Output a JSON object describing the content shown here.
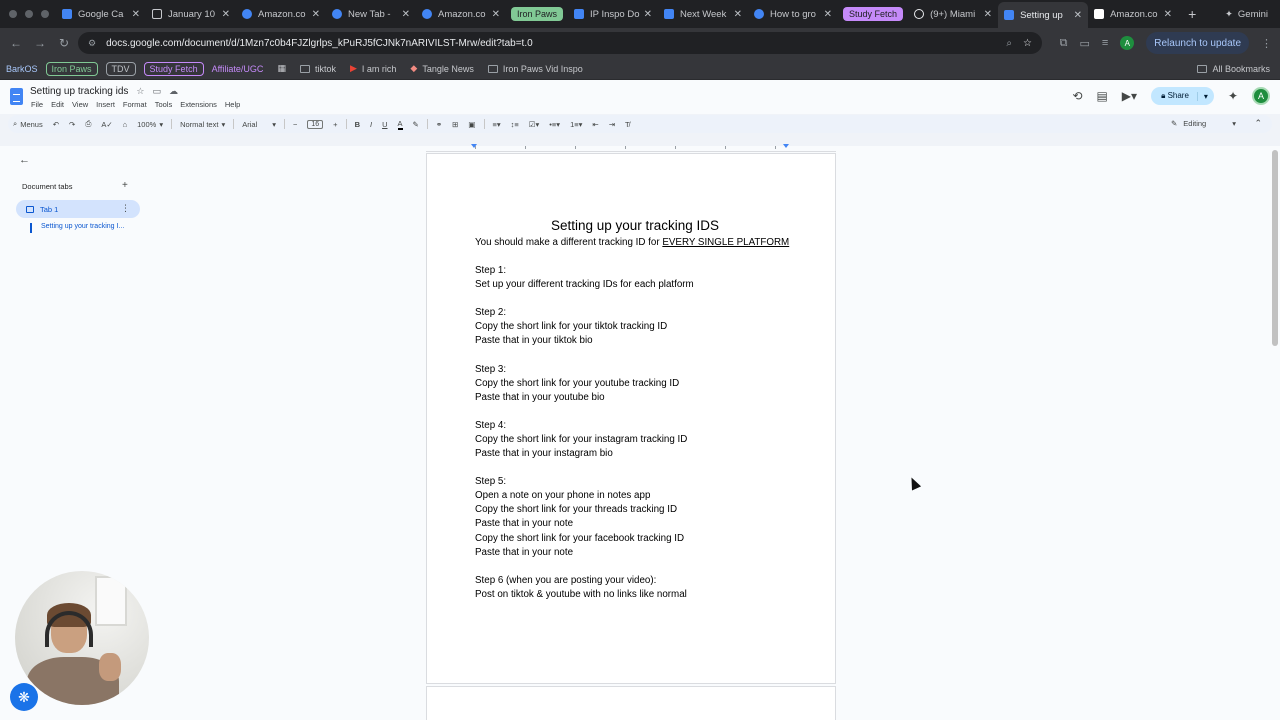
{
  "browser": {
    "tabs": [
      {
        "title": "Google Ca",
        "icon": "calendar-icon",
        "color": "#4285f4"
      },
      {
        "title": "January 10",
        "icon": "pen-icon",
        "color": "#c6c8cc"
      },
      {
        "title": "Amazon.co",
        "icon": "circle-icon",
        "color": "#4285f4"
      },
      {
        "title": "New Tab -",
        "icon": "circle-icon",
        "color": "#4285f4"
      },
      {
        "title": "Amazon.co",
        "icon": "circle-icon",
        "color": "#4285f4"
      }
    ],
    "group_iron": {
      "label": "Iron Paws",
      "color": "#81c995"
    },
    "tabs2": [
      {
        "title": "IP Inspo Do",
        "icon": "docs-icon",
        "color": "#4285f4"
      },
      {
        "title": "Next Week",
        "icon": "docs-icon",
        "color": "#4285f4"
      },
      {
        "title": "How to gro",
        "icon": "circle-icon",
        "color": "#4285f4"
      }
    ],
    "group_study": {
      "label": "Study Fetch",
      "color": "#c58af9"
    },
    "tabs3": [
      {
        "title": "(9+) Miami",
        "icon": "threads-icon",
        "color": "#e8eaed"
      },
      {
        "title": "Setting up",
        "icon": "docs-icon",
        "color": "#4285f4",
        "active": true
      },
      {
        "title": "Amazon.co",
        "icon": "amazon-icon",
        "color": "#ffffff"
      }
    ],
    "new_tab": "+",
    "gemini": "Gemini",
    "url": "docs.google.com/document/d/1Mzn7c0b4FJZlgrlps_kPuRJ5fCJNk7nARIVILST-Mrw/edit?tab=t.0",
    "relaunch": "Relaunch to update",
    "profile_initial": "A"
  },
  "bookmarks": {
    "items": [
      {
        "label": "BarkOS",
        "type": "text",
        "color": "#a8c7fa"
      },
      {
        "label": "Iron Paws",
        "type": "chip",
        "color": "#81c995"
      },
      {
        "label": "TDV",
        "type": "chip",
        "color": "#9aa0a6"
      },
      {
        "label": "Study Fetch",
        "type": "chip",
        "color": "#c58af9"
      },
      {
        "label": "Affiliate/UGC",
        "type": "text",
        "color": "#c58af9"
      }
    ],
    "folders": [
      "tiktok",
      "I am rich",
      "Tangle News",
      "Iron Paws Vid Inspo"
    ],
    "all": "All Bookmarks"
  },
  "docs": {
    "title": "Setting up tracking ids",
    "menu": [
      "File",
      "Edit",
      "View",
      "Insert",
      "Format",
      "Tools",
      "Extensions",
      "Help"
    ],
    "share": "Share",
    "profile_initial": "A",
    "toolbar": {
      "menus": "Menus",
      "zoom": "100%",
      "style": "Normal text",
      "font": "Arial",
      "font_size": "16",
      "mode": "Editing"
    },
    "side": {
      "tabs_header": "Document tabs",
      "tab_name": "Tab 1",
      "outline_item": "Setting up your tracking I..."
    },
    "content": {
      "heading": "Setting up your tracking IDS",
      "intro_prefix": "You should make a different tracking ID for ",
      "intro_underlined": "EVERY SINGLE PLATFORM",
      "steps": [
        "Step 1:\nSet up your different tracking IDs for each platform",
        "Step 2:\nCopy the short link for your tiktok tracking ID\nPaste that in your tiktok bio",
        "Step 3:\nCopy the short link for your youtube tracking ID\nPaste that in your youtube bio",
        "Step 4:\nCopy the short link for your instagram tracking ID\nPaste that in your instagram bio",
        "Step 5:\nOpen a note on your phone in notes app\nCopy the short link for your threads tracking ID\nPaste that in your note\nCopy the short link for your facebook tracking ID\nPaste that in your note",
        "Step 6 (when you are posting your video):\nPost on tiktok & youtube with no links like normal"
      ]
    }
  }
}
